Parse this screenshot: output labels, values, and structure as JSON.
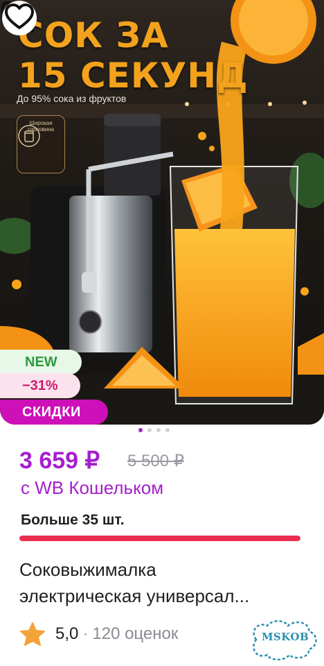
{
  "product_image": {
    "headline": "СОК ЗА\n15 СЕКУНД",
    "subheadline": "До 95% сока из фруктов",
    "feature_badge": "Широкая горловина",
    "carousel": {
      "count": 4,
      "active_index": 0
    }
  },
  "actions": {
    "zoom_icon": "search-zoom-icon",
    "favorite_icon": "heart-outline-icon"
  },
  "badges": {
    "new": "NEW",
    "discount": "−31%",
    "sale": "СКИДКИ"
  },
  "price": {
    "current": "3 659 ₽",
    "old": "5 500 ₽",
    "wallet_note": "с WB Кошельком"
  },
  "stock": {
    "text": "Больше 35 шт.",
    "fill_fraction": 1.0
  },
  "product": {
    "title_line1": "Соковыжималка",
    "title_line2": "электрическая универсал..."
  },
  "rating": {
    "value": "5,0",
    "separator": "·",
    "count": "120 оценок"
  },
  "watermark": "MSKOB",
  "colors": {
    "price": "#a51fcd",
    "sale_badge": "#cd10b8",
    "stock_bar": "#ea2e4f",
    "star": "#f2a33a"
  }
}
